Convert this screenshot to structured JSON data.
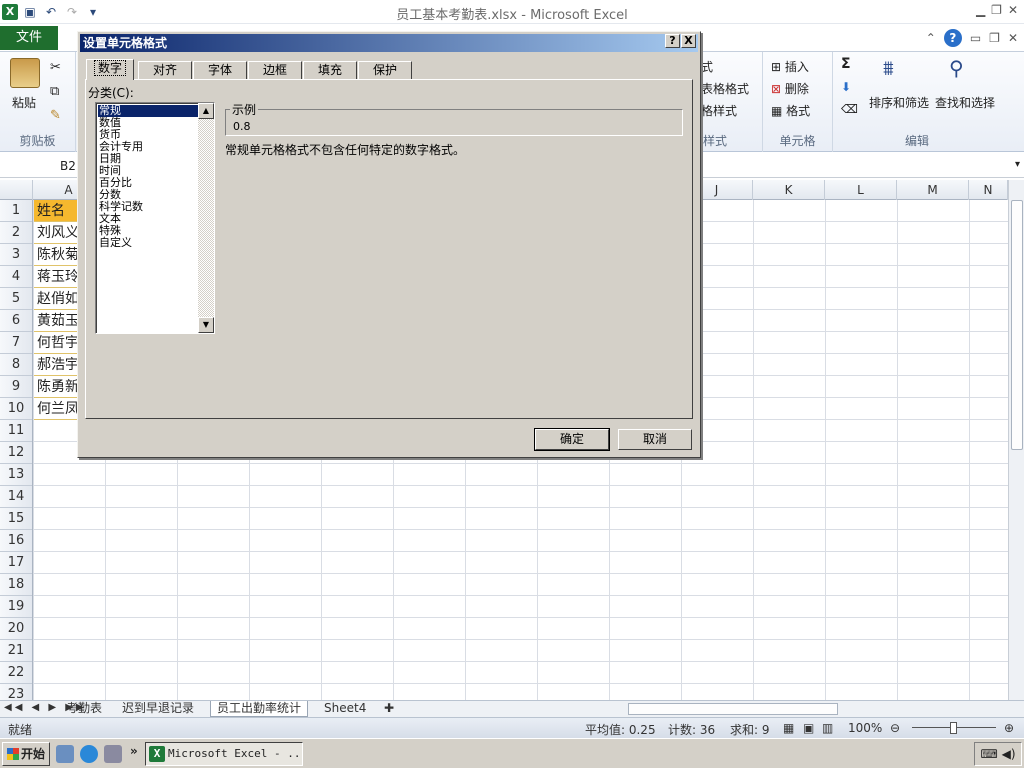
{
  "window": {
    "title": "员工基本考勤表.xlsx - Microsoft Excel",
    "file_tab": "文件",
    "app_icon": "X"
  },
  "ribbon": {
    "paste_label": "粘贴",
    "clipboard_label": "剪贴板",
    "style_items": [
      "式",
      "表格格式",
      "格样式"
    ],
    "style_group_tail": "样式",
    "cells_items": [
      "插入",
      "删除",
      "格式"
    ],
    "cells_label": "单元格",
    "editing": {
      "sum_symbol": "Σ",
      "sort_label": "排序和筛选",
      "find_label": "查找和选择",
      "group_label": "编辑"
    }
  },
  "formula_bar": {
    "name_box": "B2"
  },
  "grid": {
    "column_headers": [
      "A",
      "J",
      "K",
      "L",
      "M",
      "N"
    ],
    "row_numbers": [
      "1",
      "2",
      "3",
      "4",
      "5",
      "6",
      "7",
      "8",
      "9",
      "10",
      "11",
      "12",
      "13",
      "14",
      "15",
      "16",
      "17",
      "18",
      "19",
      "20",
      "21",
      "22",
      "23"
    ],
    "column_a": [
      "姓名",
      "刘风义",
      "陈秋菊",
      "蒋玉玲",
      "赵俏如",
      "黄茹玉",
      "何哲宇",
      "郝浩宇",
      "陈勇新",
      "何兰凤"
    ]
  },
  "sheets": {
    "nav": "◀◀ ◀ ▶ ▶▶",
    "tabs": [
      "考勤表",
      "迟到早退记录",
      "员工出勤率统计",
      "Sheet4"
    ],
    "active_index": 2
  },
  "status": {
    "ready": "就绪",
    "average": "平均值: 0.25",
    "count": "计数: 36",
    "sum": "求和: 9",
    "zoom": "100%"
  },
  "taskbar": {
    "start": "开始",
    "more": "»",
    "window_item": "Microsoft Excel - ..."
  },
  "dialog": {
    "title": "设置单元格格式",
    "help": "?",
    "close": "X",
    "tabs": [
      "数字",
      "对齐",
      "字体",
      "边框",
      "填充",
      "保护"
    ],
    "active_tab": 0,
    "category_label": "分类(C):",
    "categories": [
      "常规",
      "数值",
      "货币",
      "会计专用",
      "日期",
      "时间",
      "百分比",
      "分数",
      "科学记数",
      "文本",
      "特殊",
      "自定义"
    ],
    "selected_category": 0,
    "sample_label": "示例",
    "sample_value": "0.8",
    "description": "常规单元格格式不包含任何特定的数字格式。",
    "ok": "确定",
    "cancel": "取消"
  },
  "colors": {
    "header_fill": "#f5b82e",
    "file_tab": "#1f6e2e",
    "dialog_title": "#0a246a"
  }
}
